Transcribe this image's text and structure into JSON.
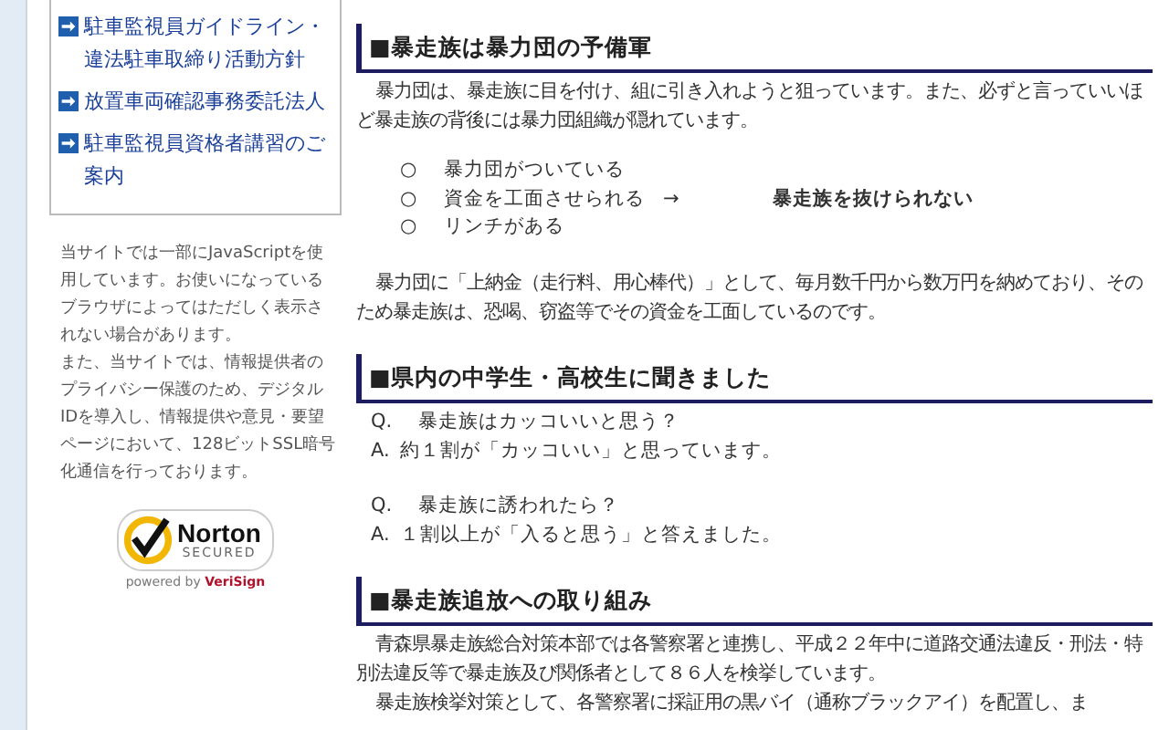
{
  "sidebar": {
    "links": [
      {
        "text": "駐車監視員ガイドライン・違法駐車取締り活動方針"
      },
      {
        "text": "放置車両確認事務委託法人"
      },
      {
        "text": "駐車監視員資格者講習のご案内"
      }
    ],
    "notes": [
      "当サイトでは一部にJavaScriptを使用しています。お使いになっているブラウザによってはただしく表示されない場合があります。",
      "また、当サイトでは、情報提供者のプライバシー保護のため、デジタルIDを導入し、情報提供や意見・要望ページにおいて、128ビットSSL暗号化通信を行っております。"
    ],
    "badge": {
      "name": "Norton",
      "sub": "SECURED",
      "footer": "powered by ",
      "brand": "VeriSign"
    }
  },
  "sections": [
    {
      "heading": "■暴走族は暴力団の予備軍",
      "blocks": [
        {
          "kind": "para",
          "text": "暴力団は、暴走族に目を付け、組に引き入れようと狙っています。また、必ずと言っていいほど暴走族の背後には暴力団組織が隠れています。"
        },
        {
          "kind": "causes",
          "items": [
            {
              "mark": "○",
              "text": "暴力団がついている"
            },
            {
              "mark": "○",
              "text": "資金を工面させられる"
            },
            {
              "mark": "○",
              "text": "リンチがある"
            }
          ],
          "arrow": "→",
          "result": "暴走族を抜けられない"
        },
        {
          "kind": "para",
          "text": "暴力団に「上納金（走行料、用心棒代）」として、毎月数千円から数万円を納めており、そのため暴走族は、恐喝、窃盗等でその資金を工面しているのです。"
        }
      ]
    },
    {
      "heading": "■県内の中学生・高校生に聞きました",
      "blocks": [
        {
          "kind": "qa",
          "q": "Q.",
          "question": "暴走族はカッコいいと思う？",
          "a": "A.",
          "answer": "約１割が「カッコいい」と思っています。"
        },
        {
          "kind": "qa",
          "q": "Q.",
          "question": "暴走族に誘われたら？",
          "a": "A.",
          "answer": "１割以上が「入ると思う」と答えました。"
        }
      ]
    },
    {
      "heading": "■暴走族追放への取り組み",
      "blocks": [
        {
          "kind": "para",
          "text": "青森県暴走族総合対策本部では各警察署と連携し、平成２２年中に道路交通法違反・刑法・特別法違反等で暴走族及び関係者として８６人を検挙しています。"
        },
        {
          "kind": "para",
          "text": "暴走族検挙対策として、各警察署に採証用の黒バイ（通称ブラックアイ）を配置し、ま"
        }
      ]
    }
  ]
}
